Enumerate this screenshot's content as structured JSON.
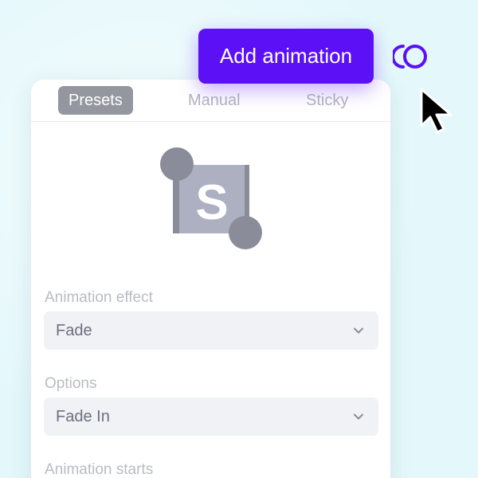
{
  "tabs": [
    {
      "label": "Presets",
      "active": true
    },
    {
      "label": "Manual",
      "active": false
    },
    {
      "label": "Sticky",
      "active": false
    }
  ],
  "illustration": {
    "icon": "transform-handles-icon",
    "letter": "S"
  },
  "fields": {
    "effect": {
      "label": "Animation effect",
      "value": "Fade"
    },
    "options": {
      "label": "Options",
      "value": "Fade In"
    },
    "starts": {
      "label": "Animation starts"
    }
  },
  "add_button": {
    "label": "Add animation"
  },
  "icons": {
    "chevron": "chevron-down-icon",
    "logo": "logo-icon",
    "cursor": "cursor-icon"
  },
  "colors": {
    "accent": "#5b10f5",
    "active_tab": "#9597a0",
    "background": "#e4f8fb"
  }
}
